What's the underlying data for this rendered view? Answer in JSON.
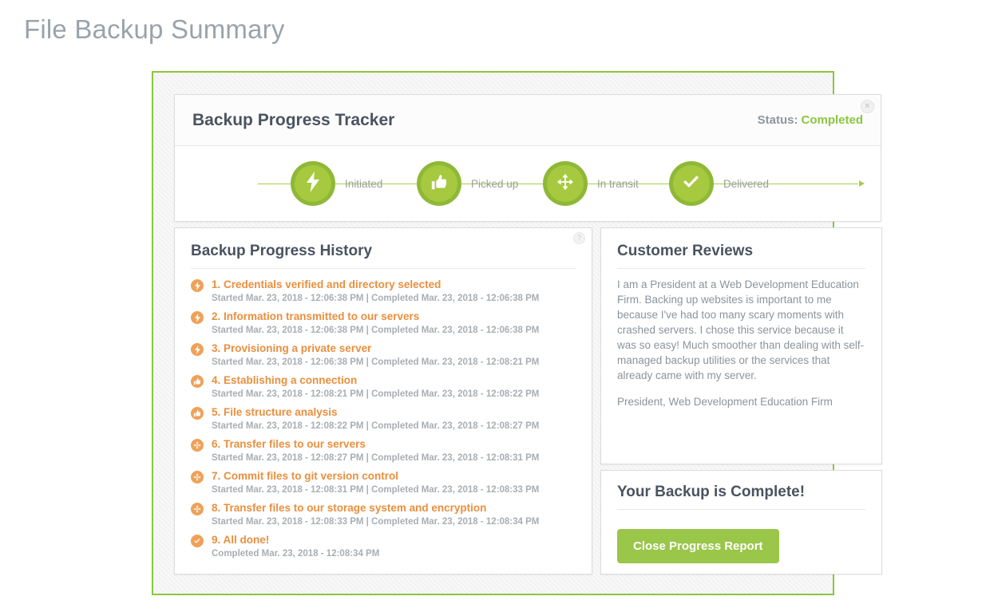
{
  "page": {
    "title": "File Backup Summary"
  },
  "colors": {
    "accent_green": "#8cc63f",
    "button_green": "#9ac64a",
    "step_green": "#a6c93f",
    "history_orange": "#e98f3e",
    "title_slate": "#4a5360",
    "muted_gray": "#8b949c"
  },
  "tracker": {
    "title": "Backup Progress Tracker",
    "status_label": "Status:",
    "status_value": "Completed",
    "close_icon": "close-icon",
    "steps": [
      {
        "icon": "bolt-icon",
        "label": "Initiated"
      },
      {
        "icon": "thumbs-up-icon",
        "label": "Picked up"
      },
      {
        "icon": "move-arrows-icon",
        "label": "In transit"
      },
      {
        "icon": "check-icon",
        "label": "Delivered"
      }
    ]
  },
  "history": {
    "title": "Backup Progress History",
    "help_icon": "help-icon",
    "items": [
      {
        "icon": "bolt-icon",
        "title": "1. Credentials verified and directory selected",
        "meta": "Started Mar. 23, 2018 - 12:06:38 PM | Completed Mar. 23, 2018 - 12:06:38 PM"
      },
      {
        "icon": "bolt-icon",
        "title": "2. Information transmitted to our servers",
        "meta": "Started Mar. 23, 2018 - 12:06:38 PM | Completed Mar. 23, 2018 - 12:06:38 PM"
      },
      {
        "icon": "bolt-icon",
        "title": "3. Provisioning a private server",
        "meta": "Started Mar. 23, 2018 - 12:06:38 PM | Completed Mar. 23, 2018 - 12:08:21 PM"
      },
      {
        "icon": "thumbs-up-icon",
        "title": "4. Establishing a connection",
        "meta": "Started Mar. 23, 2018 - 12:08:21 PM | Completed Mar. 23, 2018 - 12:08:22 PM"
      },
      {
        "icon": "thumbs-up-icon",
        "title": "5. File structure analysis",
        "meta": "Started Mar. 23, 2018 - 12:08:22 PM | Completed Mar. 23, 2018 - 12:08:27 PM"
      },
      {
        "icon": "move-arrows-icon",
        "title": "6. Transfer files to our servers",
        "meta": "Started Mar. 23, 2018 - 12:08:27 PM | Completed Mar. 23, 2018 - 12:08:31 PM"
      },
      {
        "icon": "move-arrows-icon",
        "title": "7. Commit files to git version control",
        "meta": "Started Mar. 23, 2018 - 12:08:31 PM | Completed Mar. 23, 2018 - 12:08:33 PM"
      },
      {
        "icon": "move-arrows-icon",
        "title": "8. Transfer files to our storage system and encryption",
        "meta": "Started Mar. 23, 2018 - 12:08:33 PM | Completed Mar. 23, 2018 - 12:08:34 PM"
      },
      {
        "icon": "check-icon",
        "title": "9. All done!",
        "meta": "Completed Mar. 23, 2018 - 12:08:34 PM"
      }
    ]
  },
  "reviews": {
    "title": "Customer Reviews",
    "body": "I am a President at a Web Development Education Firm. Backing up websites is important to me because I've had too many scary moments with crashed servers. I chose this service because it was so easy! Much smoother than dealing with self-managed backup utilities or the services that already came with my server.",
    "author": "President, Web Development Education Firm"
  },
  "complete": {
    "title": "Your Backup is Complete!",
    "button_label": "Close Progress Report"
  }
}
